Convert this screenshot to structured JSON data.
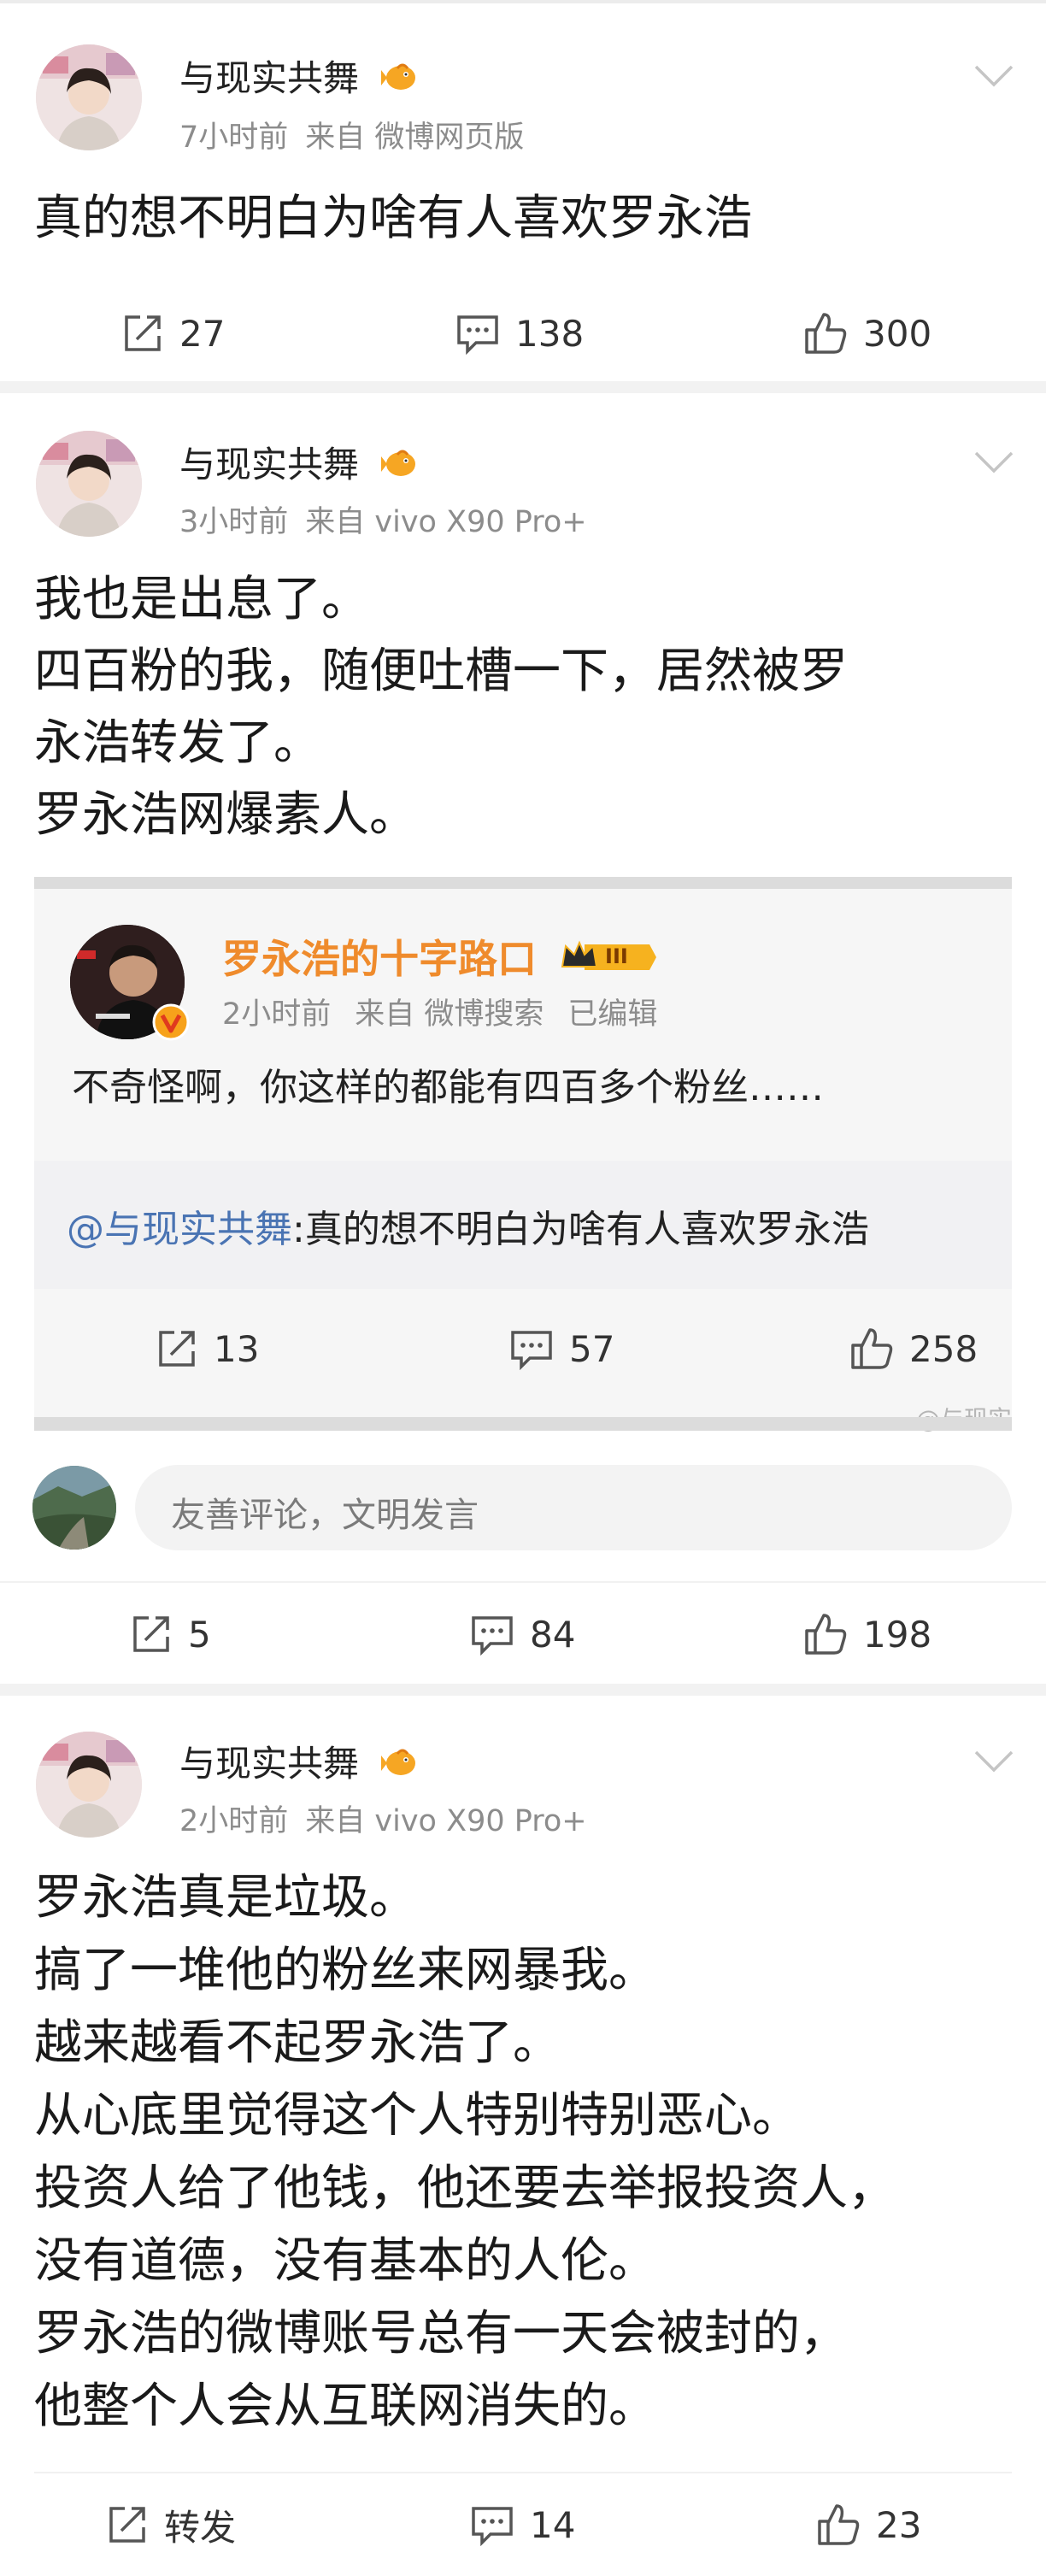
{
  "post1": {
    "username": "与现实共舞",
    "time": "7小时前",
    "source": "来自 微博网页版",
    "text": "真的想不明白为啥有人喜欢罗永浩",
    "repost_count": "27",
    "comment_count": "138",
    "like_count": "300"
  },
  "post2": {
    "username": "与现实共舞",
    "time": "3小时前",
    "source": "来自 vivo X90 Pro+",
    "text": "我也是出息了。\n四百粉的我，随便吐槽一下，居然被罗\n永浩转发了。\n罗永浩网爆素人。",
    "repost": {
      "username": "罗永浩的十字路口",
      "level_badge": "III",
      "time": "2小时前",
      "source": "来自 微博搜索",
      "edited": "已编辑",
      "text": "不奇怪啊，你这样的都能有四百多个粉丝……",
      "original_mention": "@与现实共舞",
      "original_text": ":真的想不明白为啥有人喜欢罗永浩",
      "repost_count": "13",
      "comment_count": "57",
      "like_count": "258",
      "watermark": "@与现实"
    },
    "comment_placeholder": "友善评论，文明发言",
    "repost_count": "5",
    "comment_count": "84",
    "like_count": "198"
  },
  "post3": {
    "username": "与现实共舞",
    "time": "2小时前",
    "source": "来自 vivo X90 Pro+",
    "text": "罗永浩真是垃圾。\n搞了一堆他的粉丝来网暴我。\n越来越看不起罗永浩了。\n从心底里觉得这个人特别特别恶心。\n投资人给了他钱，他还要去举报投资人，\n没有道德，没有基本的人伦。\n罗永浩的微博账号总有一天会被封的，\n他整个人会从互联网消失的。",
    "repost_label": "转发",
    "comment_count": "14",
    "like_count": "23"
  },
  "colors": {
    "orange_name": "#ef8b2c",
    "mention_blue": "#4a74b3",
    "meta_gray": "#8c8c8c"
  }
}
